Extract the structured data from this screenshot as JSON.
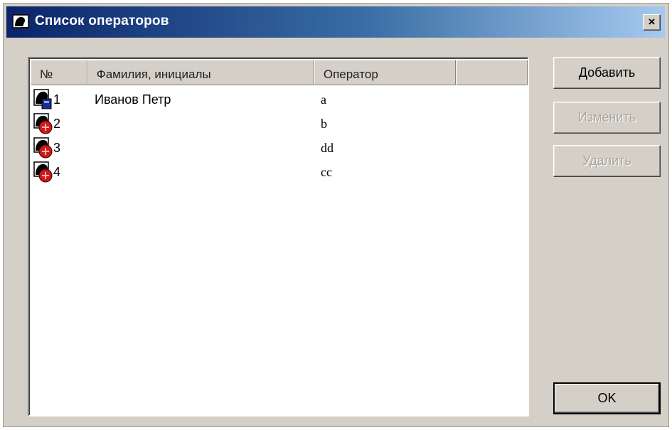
{
  "window": {
    "title": "Список операторов",
    "close_label": "×"
  },
  "listview": {
    "columns": [
      "№",
      "Фамилия, инициалы",
      "Оператор",
      ""
    ],
    "rows": [
      {
        "num": "1",
        "name": "Иванов Петр",
        "operator": "a",
        "icon": "operator-blue-icon"
      },
      {
        "num": "2",
        "name": "",
        "operator": "b",
        "icon": "operator-red-icon"
      },
      {
        "num": "3",
        "name": "",
        "operator": "dd",
        "icon": "operator-red-icon"
      },
      {
        "num": "4",
        "name": "",
        "operator": "cc",
        "icon": "operator-red-icon"
      }
    ]
  },
  "buttons": {
    "add": "Добавить",
    "edit": "Изменить",
    "delete": "Удалить",
    "ok": "OK"
  },
  "colors": {
    "title_start": "#0a246a",
    "title_end": "#a6caf0",
    "face": "#d4d0c8",
    "icon_blue": "#1a2c8c",
    "icon_red": "#d01818"
  }
}
